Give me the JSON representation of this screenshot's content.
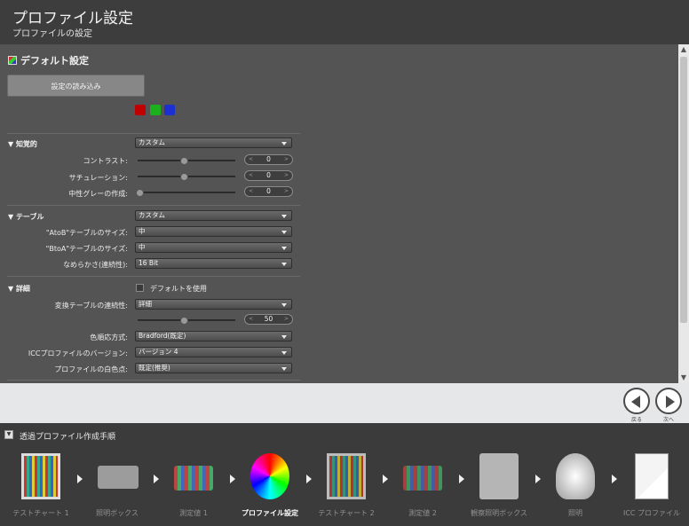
{
  "header": {
    "title": "プロファイル設定",
    "subtitle": "プロファイルの設定"
  },
  "panel": {
    "section_title": "デフォルト設定",
    "load_button": "設定の読み込み",
    "swatches": [
      "#c00000",
      "#1db01d",
      "#1c2fd0"
    ],
    "perceptual": {
      "title": "知覚的",
      "mode": "カスタム",
      "contrast_label": "コントラスト:",
      "contrast_value": "0",
      "saturation_label": "サチュレーション:",
      "saturation_value": "0",
      "neutral_label": "中性グレーの作成:",
      "neutral_value": "0"
    },
    "table": {
      "title": "テーブル",
      "mode": "カスタム",
      "atob_label": "\"AtoB\"テーブルのサイズ:",
      "atob_value": "中",
      "btoa_label": "\"BtoA\"テーブルのサイズ:",
      "btoa_value": "中",
      "smooth_label": "なめらかさ(連続性):",
      "smooth_value": "16 Bit"
    },
    "details": {
      "title": "詳細",
      "use_default_label": "デフォルトを使用",
      "continuity_label": "変換テーブルの連続性:",
      "continuity_value": "詳細",
      "continuity_num": "50",
      "chromatic_label": "色順応方式:",
      "chromatic_value": "Bradford(既定)",
      "icc_label": "ICCプロファイルのバージョン:",
      "icc_value": "バージョン 4",
      "white_label": "プロファイルの白色点:",
      "white_value": "既定(推奨)"
    }
  },
  "nav": {
    "back_label": "戻る",
    "next_label": "次へ"
  },
  "workflow": {
    "title": "透過プロファイル作成手順",
    "steps": [
      {
        "label": "テストチャート 1",
        "icon": "test-chart-icon"
      },
      {
        "label": "照明ボックス",
        "icon": "light-box-icon"
      },
      {
        "label": "測定値 1",
        "icon": "measure-icon"
      },
      {
        "label": "プロファイル設定",
        "icon": "gear-gamut-icon"
      },
      {
        "label": "テストチャート 2",
        "icon": "test-chart-icon"
      },
      {
        "label": "測定値 2",
        "icon": "measure-icon"
      },
      {
        "label": "観察照明ボックス",
        "icon": "viewing-box-icon"
      },
      {
        "label": "照明",
        "icon": "bulb-gear-icon"
      },
      {
        "label": "ICC プロファイル",
        "icon": "icc-doc-icon"
      }
    ]
  }
}
